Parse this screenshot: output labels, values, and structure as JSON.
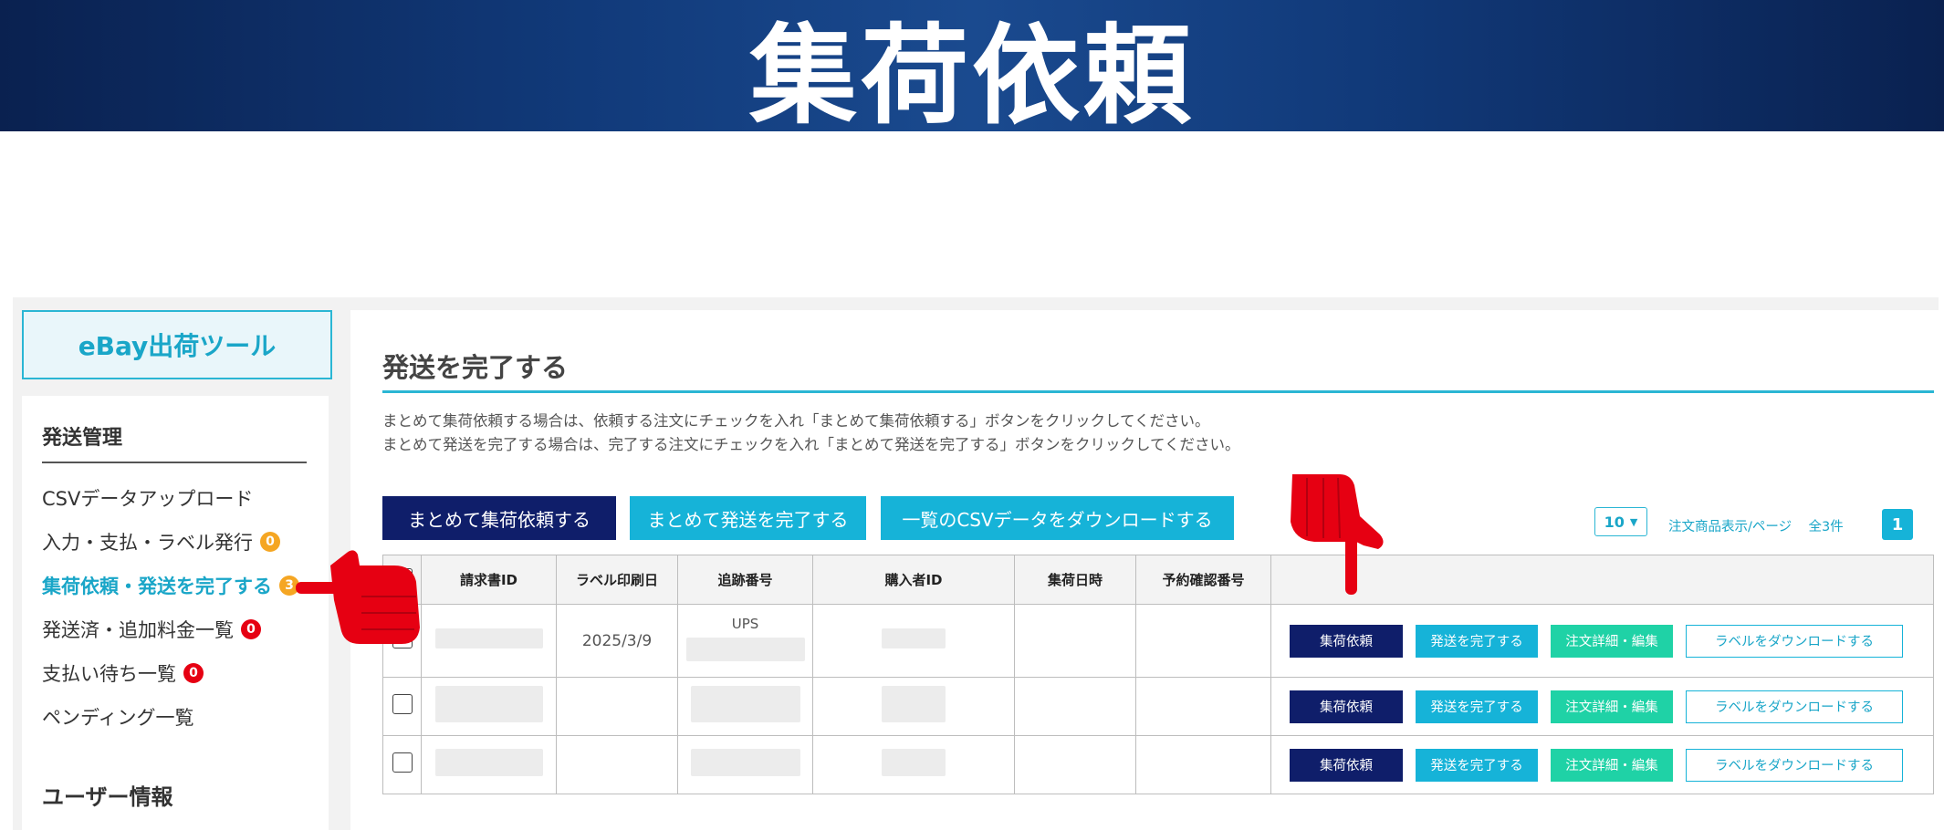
{
  "banner": {
    "title": "集荷依頼"
  },
  "app": {
    "logo": "eBay出荷ツール"
  },
  "sidebar": {
    "heading": "発送管理",
    "items": [
      {
        "label": "CSVデータアップロード",
        "badge": null
      },
      {
        "label": "入力・支払・ラベル発行",
        "badge": "0"
      },
      {
        "label": "集荷依頼・発送を完了する",
        "badge": "3"
      },
      {
        "label": "発送済・追加料金一覧",
        "badge": "0"
      },
      {
        "label": "支払い待ち一覧",
        "badge": "0"
      },
      {
        "label": "ペンディング一覧",
        "badge": null
      }
    ],
    "user_heading": "ユーザー情報"
  },
  "main": {
    "title": "発送を完了する",
    "desc1": "まとめて集荷依頼する場合は、依頼する注文にチェックを入れ「まとめて集荷依頼する」ボタンをクリックしてください。",
    "desc2": "まとめて発送を完了する場合は、完了する注文にチェックを入れ「まとめて発送を完了する」ボタンをクリックしてください。",
    "buttons": {
      "bulk_pickup": "まとめて集荷依頼する",
      "bulk_complete": "まとめて発送を完了する",
      "csv_download": "一覧のCSVデータをダウンロードする"
    },
    "pager": {
      "per_page": "10",
      "per_page_label": "注文商品表示/ページ",
      "total": "全3件",
      "current_page": "1"
    }
  },
  "table": {
    "headers": [
      "請求書ID",
      "ラベル印刷日",
      "追跡番号",
      "購入者ID",
      "集荷日時",
      "予約確認番号"
    ],
    "rows": [
      {
        "label_date": "2025/3/9",
        "carrier": "UPS"
      },
      {
        "label_date": "",
        "carrier": ""
      },
      {
        "label_date": "",
        "carrier": ""
      }
    ],
    "actions": {
      "pickup": "集荷依頼",
      "complete": "発送を完了する",
      "detail": "注文詳細・編集",
      "label": "ラベルをダウンロードする"
    }
  },
  "colors": {
    "accent": "#16b3d8",
    "navy": "#0f1e6a",
    "green": "#1fd2a6",
    "badge_red": "#e60012",
    "badge_orange": "#f5a623",
    "pointer_red": "#e60012"
  }
}
